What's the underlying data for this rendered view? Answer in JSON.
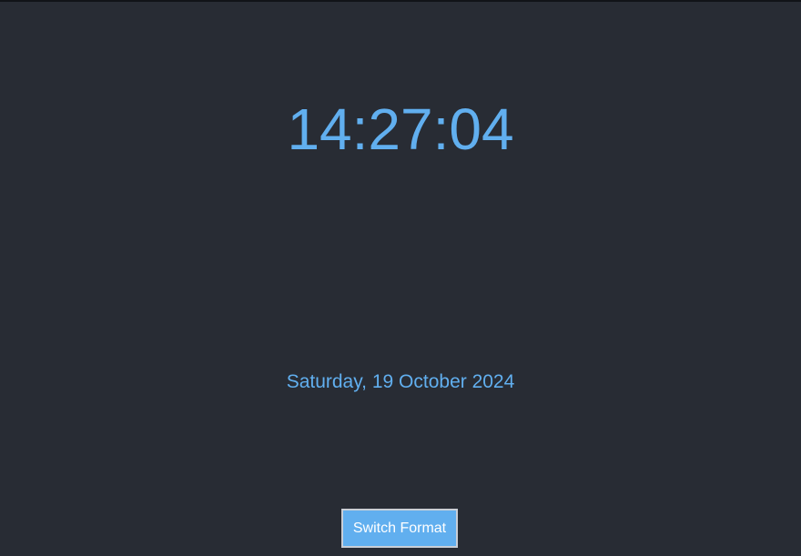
{
  "clock": {
    "time": "14:27:04",
    "date": "Saturday, 19 October 2024"
  },
  "controls": {
    "switch_format_label": "Switch Format"
  },
  "colors": {
    "background": "#282c34",
    "accent": "#61afef",
    "button_text": "#ffffff"
  }
}
